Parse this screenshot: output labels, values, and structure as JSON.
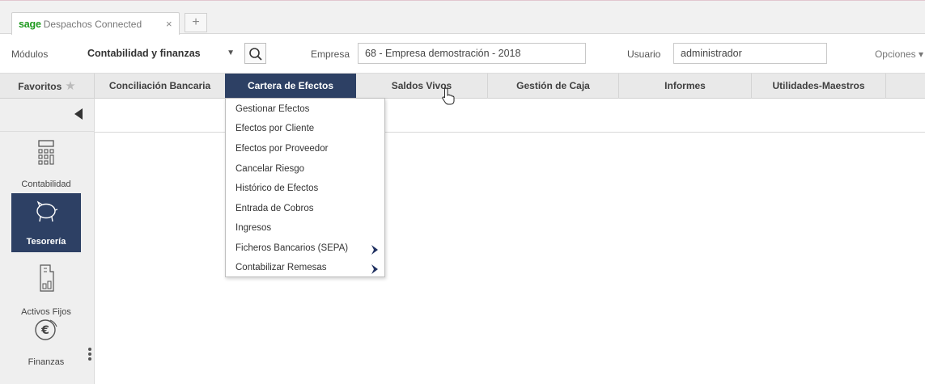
{
  "tab": {
    "brand": "sage",
    "app": "Despachos Connected",
    "close": "×",
    "new": "+"
  },
  "toolbar": {
    "modulos_label": "Módulos",
    "modulos_value": "Contabilidad y finanzas",
    "empresa_label": "Empresa",
    "empresa_value": "68 - Empresa demostración - 2018",
    "usuario_label": "Usuario",
    "usuario_value": "administrador",
    "opciones_label": "Opciones ▾"
  },
  "nav": {
    "favoritos": "Favoritos",
    "items": [
      "Conciliación Bancaria",
      "Cartera de Efectos",
      "Saldos Vivos",
      "Gestión de Caja",
      "Informes",
      "Utilidades-Maestros"
    ]
  },
  "sidebar": {
    "modules": [
      "Contabilidad",
      "Tesorería",
      "Activos Fijos",
      "Finanzas"
    ]
  },
  "dropdown": {
    "items": [
      "Gestionar Efectos",
      "Efectos por Cliente",
      "Efectos por Proveedor",
      "Cancelar Riesgo",
      "Histórico de Efectos",
      "Entrada de Cobros",
      "Ingresos",
      "Ficheros Bancarios (SEPA)",
      "Contabilizar Remesas"
    ]
  },
  "colors": {
    "active_nav": "#2d4064",
    "brand_green": "#1f9a1f",
    "chevron": "#1f3060"
  }
}
